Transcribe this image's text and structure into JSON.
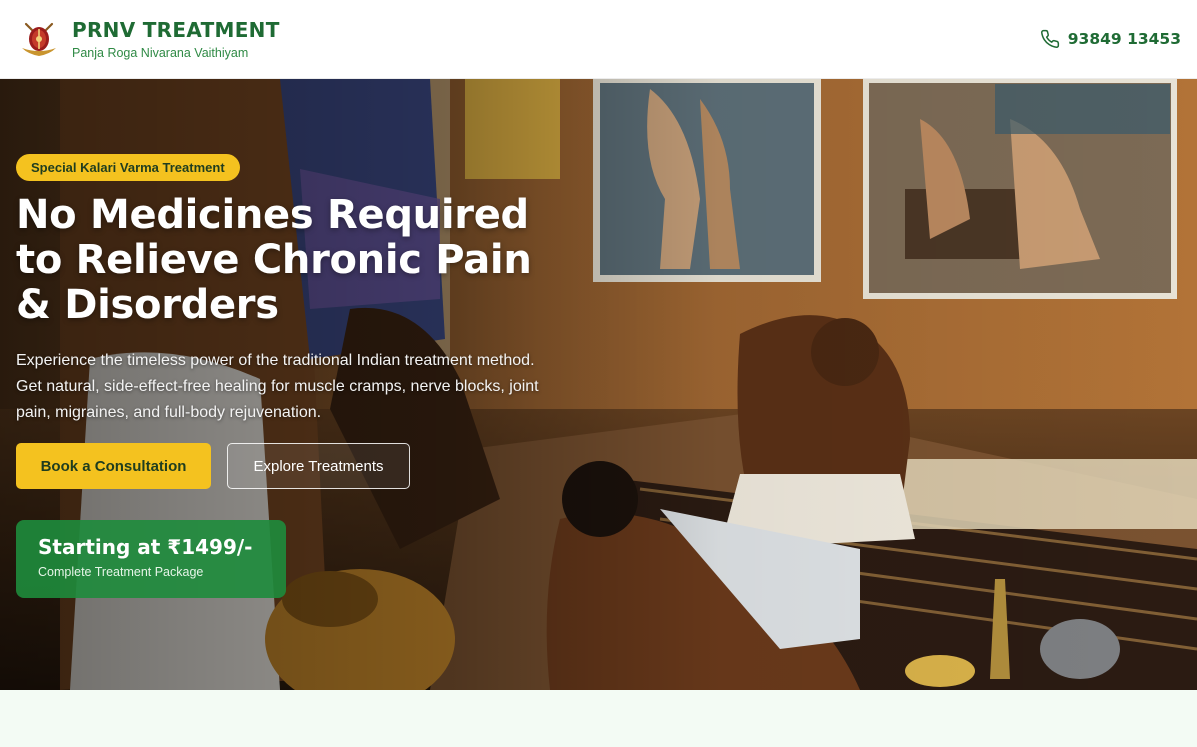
{
  "header": {
    "brand_title": "PRNV TREATMENT",
    "brand_subtitle": "Panja Roga Nivarana Vaithiyam",
    "phone": "93849 13453",
    "logo_icon": "emblem-logo-icon",
    "phone_icon": "phone-icon"
  },
  "hero": {
    "badge": "Special Kalari Varma Treatment",
    "headline": "No Medicines Required to Relieve Chronic Pain & Disorders",
    "description": "Experience the timeless power of the traditional Indian treatment method. Get natural, side-effect-free healing for muscle cramps, nerve blocks, joint pain, migraines, and full-body rejuvenation.",
    "primary_cta": "Book a Consultation",
    "secondary_cta": "Explore Treatments",
    "price": "Starting at ₹1499/-",
    "price_note": "Complete Treatment Package"
  },
  "colors": {
    "brand_green": "#1f6b34",
    "accent_yellow": "#f4c21f",
    "price_card_green": "#1e8c3c"
  }
}
